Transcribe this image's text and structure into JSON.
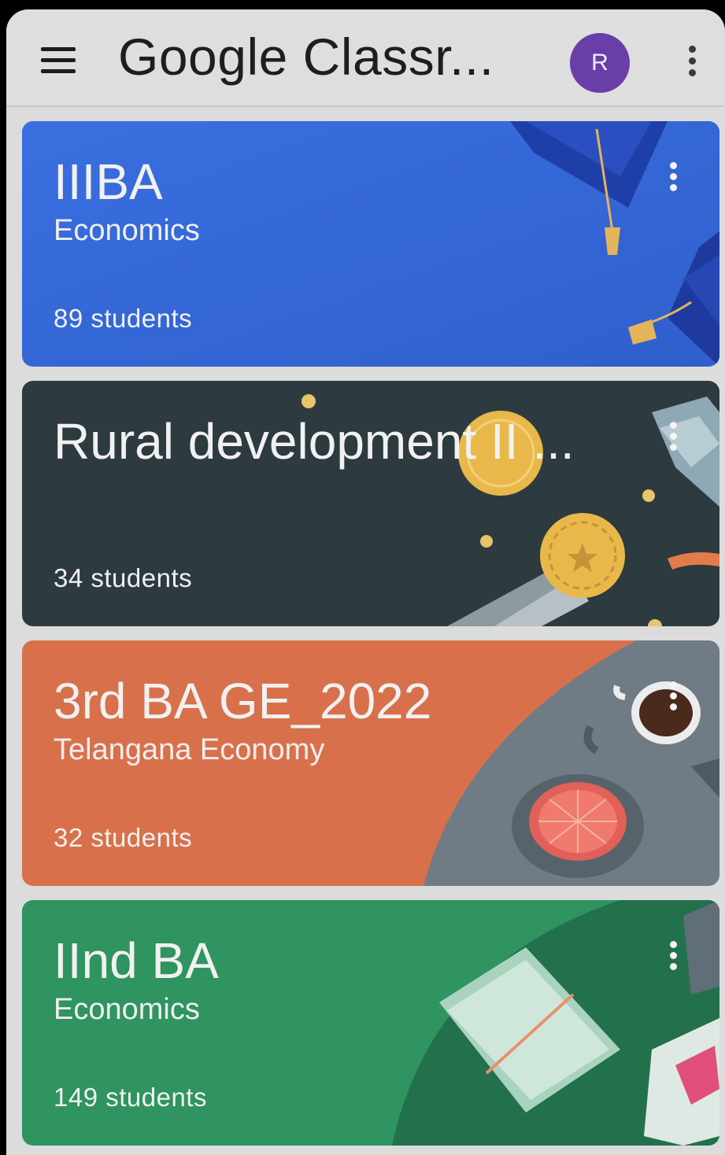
{
  "appbar": {
    "menu_icon": "hamburger-menu-icon",
    "title": "Google Classr...",
    "avatar_initial": "R",
    "more_icon": "more-vert-icon"
  },
  "classes": [
    {
      "title": "IIIBA",
      "subtitle": "Economics",
      "students": "89 students",
      "color": "#3367d6",
      "illustration": "graduation-cap"
    },
    {
      "title": "Rural development II ...",
      "subtitle": "",
      "students": "34 students",
      "color": "#2d3a40",
      "illustration": "medals"
    },
    {
      "title": "3rd BA GE_2022",
      "subtitle": "Telangana Economy",
      "students": "32 students",
      "color": "#d8714b",
      "illustration": "coffee-table"
    },
    {
      "title": "IInd BA",
      "subtitle": "Economics",
      "students": "149 students",
      "color": "#2f9460",
      "illustration": "open-books"
    }
  ],
  "colors": {
    "appbar_bg": "#dedede",
    "avatar_bg": "#6a3ea8",
    "card_text": "#f1f1f1"
  }
}
